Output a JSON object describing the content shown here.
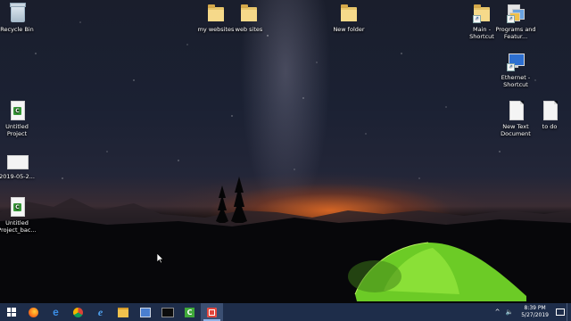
{
  "desktop": {
    "icons": [
      {
        "label": "Recycle Bin"
      },
      {
        "label": "my websites"
      },
      {
        "label": "web sites"
      },
      {
        "label": "New folder"
      },
      {
        "label": "Main - Shortcut"
      },
      {
        "label": "Programs and Featur..."
      },
      {
        "label": "Ethernet - Shortcut"
      },
      {
        "label": "Untitled Project"
      },
      {
        "label": "New Text Document"
      },
      {
        "label": "to do"
      },
      {
        "label": "2019-05-2..."
      },
      {
        "label": "Untitled Project_bac..."
      }
    ]
  },
  "taskbar": {
    "pinned": [
      {
        "icon": "start-windows-icon"
      },
      {
        "icon": "firefox-icon"
      },
      {
        "icon": "edge-icon"
      },
      {
        "icon": "chrome-icon"
      },
      {
        "icon": "internet-explorer-icon"
      },
      {
        "icon": "file-explorer-icon"
      },
      {
        "icon": "network-settings-icon"
      },
      {
        "icon": "command-prompt-icon"
      },
      {
        "icon": "camtasia-editor-icon"
      },
      {
        "icon": "camtasia-recorder-icon"
      }
    ],
    "tray": {
      "chevron": "^",
      "volume": "🔈",
      "time": "8:39 PM",
      "date": "5/27/2019"
    }
  },
  "colors": {
    "taskbar_bg": "#1e2d4a",
    "active_tab": "#3b4f72",
    "tent_green": "#7edc2a",
    "horizon_glow": "#eb6e23"
  }
}
